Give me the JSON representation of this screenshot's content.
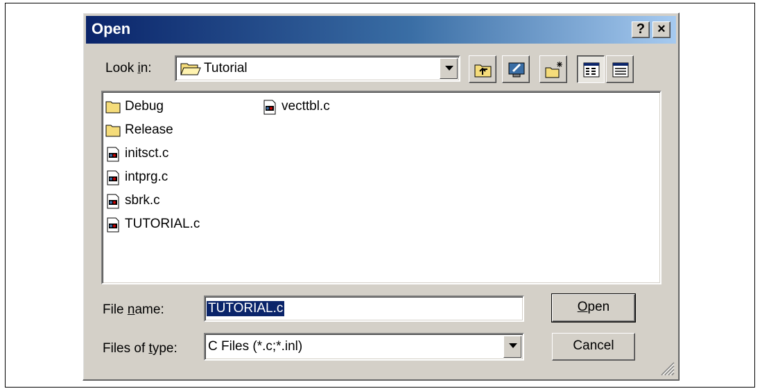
{
  "dialog": {
    "title": "Open",
    "help_label": "?",
    "close_label": "×"
  },
  "lookin": {
    "label_prefix": "Look ",
    "label_accel": "i",
    "label_suffix": "n:",
    "value": "Tutorial"
  },
  "toolbar": {
    "items": [
      "up-one-level",
      "desktop",
      "create-new-folder",
      "list-view",
      "details-view"
    ]
  },
  "files": [
    {
      "name": "Debug",
      "type": "folder"
    },
    {
      "name": "Release",
      "type": "folder"
    },
    {
      "name": "initsct.c",
      "type": "c-file"
    },
    {
      "name": "intprg.c",
      "type": "c-file"
    },
    {
      "name": "sbrk.c",
      "type": "c-file"
    },
    {
      "name": "TUTORIAL.c",
      "type": "c-file"
    },
    {
      "name": "vecttbl.c",
      "type": "c-file"
    }
  ],
  "filename": {
    "label_prefix": "File ",
    "label_accel": "n",
    "label_suffix": "ame:",
    "value": "TUTORIAL.c"
  },
  "filetype": {
    "label_prefix": "Files of ",
    "label_accel": "t",
    "label_suffix": "ype:",
    "value": "C Files (*.c;*.inl)"
  },
  "buttons": {
    "open_accel": "O",
    "open_rest": "pen",
    "cancel": "Cancel"
  }
}
